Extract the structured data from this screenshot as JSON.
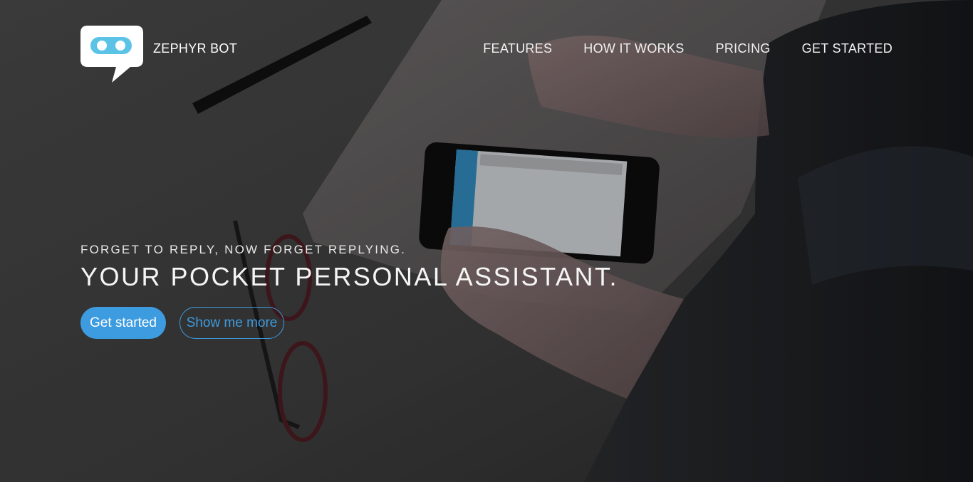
{
  "brand": {
    "name": "ZEPHYR BOT"
  },
  "nav": {
    "items": [
      {
        "label": "FEATURES"
      },
      {
        "label": "HOW IT WORKS"
      },
      {
        "label": "PRICING"
      },
      {
        "label": "GET STARTED"
      }
    ]
  },
  "hero": {
    "tagline": "FORGET TO REPLY, NOW FORGET REPLYING.",
    "headline": "YOUR POCKET PERSONAL ASSISTANT.",
    "primary_cta": "Get started",
    "secondary_cta": "Show me more",
    "background_icon": "photo-desk-phone"
  },
  "colors": {
    "accent": "#3d9be0",
    "logo_face": "#5bc3e6",
    "text": "#ffffff"
  }
}
